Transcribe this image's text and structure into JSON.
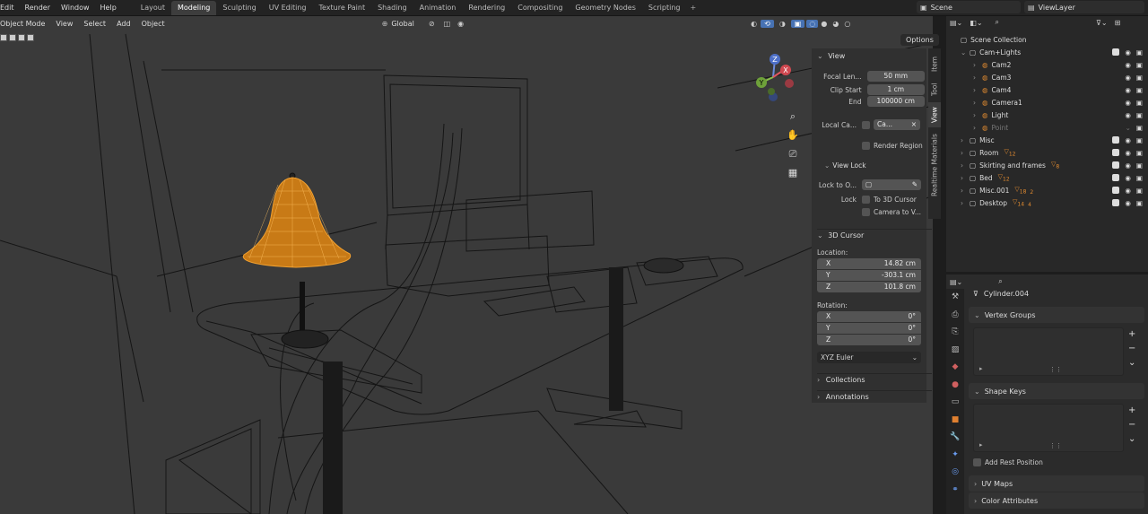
{
  "topbar": {
    "menus": [
      "Edit",
      "Render",
      "Window",
      "Help"
    ],
    "workspaces": [
      "Layout",
      "Modeling",
      "Sculpting",
      "UV Editing",
      "Texture Paint",
      "Shading",
      "Animation",
      "Rendering",
      "Compositing",
      "Geometry Nodes",
      "Scripting"
    ],
    "active_workspace": "Modeling",
    "plus": "+",
    "scene": "Scene",
    "view_layer": "ViewLayer"
  },
  "viewport_header": {
    "mode": "Object Mode",
    "menus": [
      "View",
      "Select",
      "Add",
      "Object"
    ],
    "orientation": "Global",
    "options": "Options"
  },
  "gizmo": {
    "z": "Z",
    "y": "Y",
    "x": "X"
  },
  "npanel": {
    "view_header": "View",
    "focal_label": "Focal Len...",
    "focal_value": "50 mm",
    "clip_start_label": "Clip Start",
    "clip_start_value": "1 cm",
    "end_label": "End",
    "end_value": "100000 cm",
    "local_camera_label": "Local Ca...",
    "local_camera_value": "Ca...",
    "render_region": "Render Region",
    "view_lock_header": "View Lock",
    "lock_to_object_label": "Lock to O...",
    "lock_label": "Lock",
    "to_3d_cursor": "To 3D Cursor",
    "camera_to_view": "Camera to V...",
    "cursor_header": "3D Cursor",
    "location_label": "Location:",
    "loc": [
      {
        "axis": "X",
        "value": "14.82 cm"
      },
      {
        "axis": "Y",
        "value": "-303.1 cm"
      },
      {
        "axis": "Z",
        "value": "101.8 cm"
      }
    ],
    "rotation_label": "Rotation:",
    "rot": [
      {
        "axis": "X",
        "value": "0°"
      },
      {
        "axis": "Y",
        "value": "0°"
      },
      {
        "axis": "Z",
        "value": "0°"
      }
    ],
    "rotation_mode": "XYZ Euler",
    "collections": "Collections",
    "annotations": "Annotations"
  },
  "side_tabs": [
    "Item",
    "Tool",
    "View",
    "Realtime Materials"
  ],
  "outliner": {
    "root": "Scene Collection",
    "rows": [
      {
        "name": "Cam+Lights",
        "indent": 1,
        "expanded": true
      },
      {
        "name": "Cam2",
        "indent": 2
      },
      {
        "name": "Cam3",
        "indent": 2
      },
      {
        "name": "Cam4",
        "indent": 2
      },
      {
        "name": "Camera1",
        "indent": 2
      },
      {
        "name": "Light",
        "indent": 2
      },
      {
        "name": "Point",
        "indent": 2,
        "dim": true
      },
      {
        "name": "Misc",
        "indent": 1
      },
      {
        "name": "Room",
        "indent": 1,
        "badge": "12"
      },
      {
        "name": "Skirting and frames",
        "indent": 1,
        "badge": "8"
      },
      {
        "name": "Bed",
        "indent": 1,
        "badge": "12"
      },
      {
        "name": "Misc.001",
        "indent": 1,
        "badge": "18",
        "badge2": "2"
      },
      {
        "name": "Desktop",
        "indent": 1,
        "badge": "14",
        "badge2": "4"
      }
    ]
  },
  "properties": {
    "object_name": "Cylinder.004",
    "vertex_groups": "Vertex Groups",
    "shape_keys": "Shape Keys",
    "add_rest_position": "Add Rest Position",
    "uv_maps": "UV Maps",
    "color_attributes": "Color Attributes"
  },
  "colors": {
    "accent": "#4772b3",
    "selection": "#f0a030",
    "panel": "#303030"
  }
}
